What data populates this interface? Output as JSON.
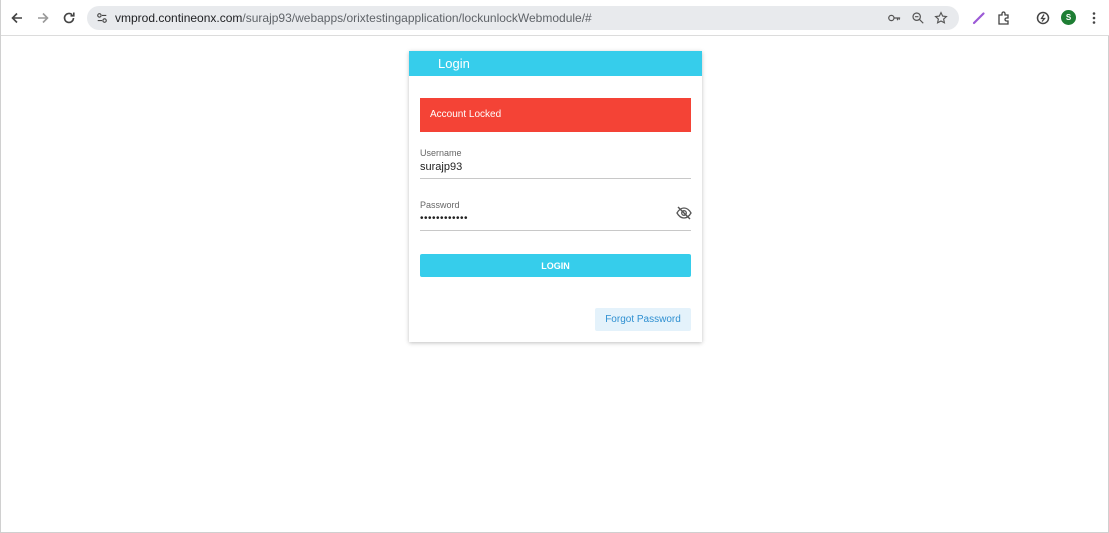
{
  "browser": {
    "url_host": "vmprod.contineonx.com",
    "url_path": "/surajp93/webapps/orixtestingapplication/lockunlockWebmodule/#",
    "avatar_letter": "S",
    "accent_color": "#f4b4a0"
  },
  "login": {
    "title": "Login",
    "header_color": "#36cdeb",
    "alert_text": "Account Locked",
    "alert_color": "#f44336",
    "username_label": "Username",
    "username_value": "surajp93",
    "password_label": "Password",
    "password_value": "••••••••••••",
    "login_label": "LOGIN",
    "forgot_label": "Forgot Password"
  }
}
